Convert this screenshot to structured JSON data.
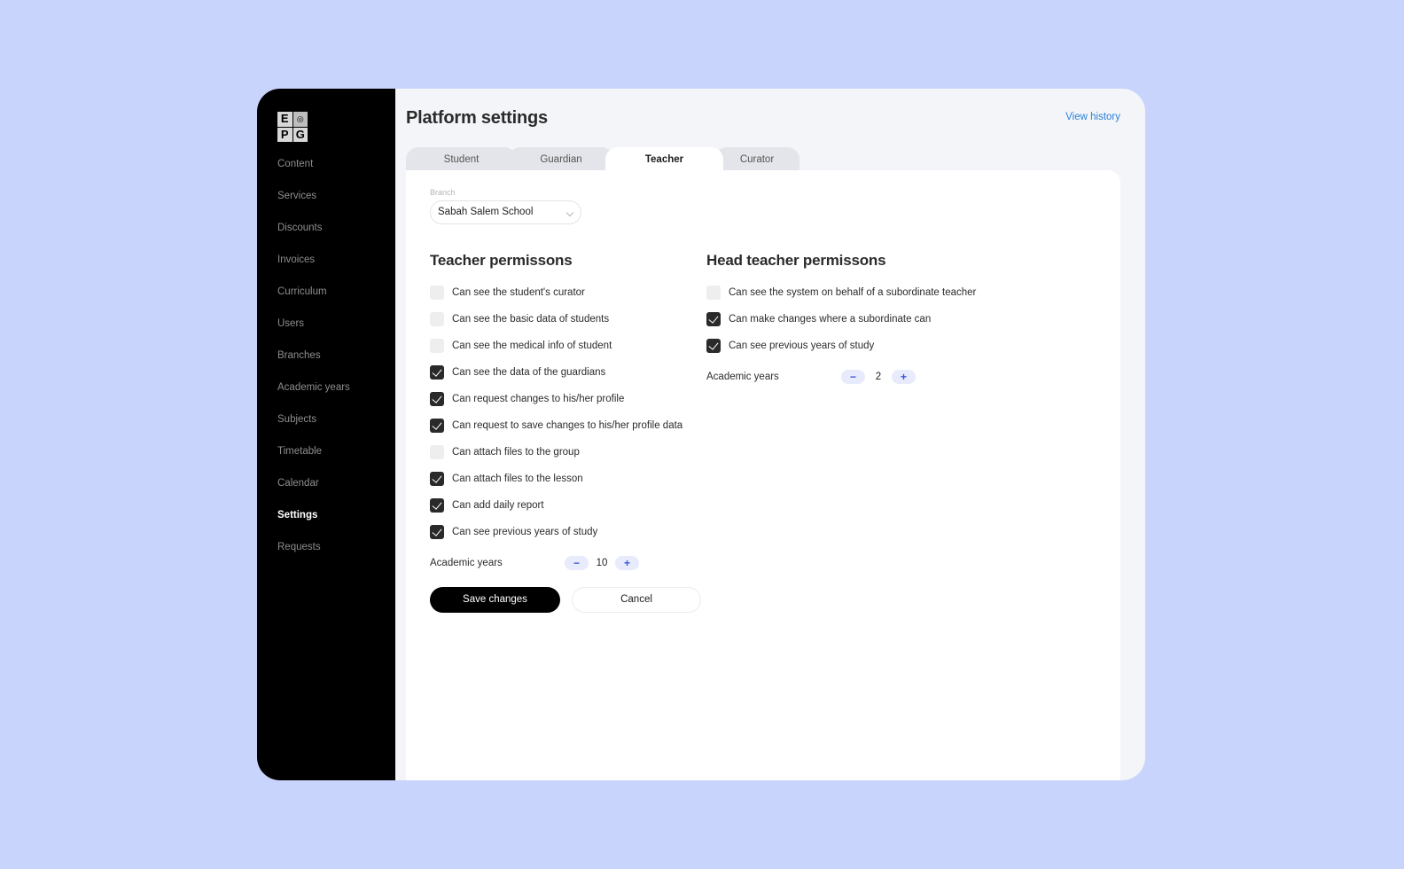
{
  "sidebar": {
    "logo": {
      "letters": [
        "E",
        "P",
        "G"
      ]
    },
    "items": [
      {
        "label": "Content"
      },
      {
        "label": "Services"
      },
      {
        "label": "Discounts"
      },
      {
        "label": "Invoices"
      },
      {
        "label": "Curriculum"
      },
      {
        "label": "Users"
      },
      {
        "label": "Branches"
      },
      {
        "label": "Academic years"
      },
      {
        "label": "Subjects"
      },
      {
        "label": "Timetable"
      },
      {
        "label": "Calendar"
      },
      {
        "label": "Settings",
        "active": true
      },
      {
        "label": "Requests"
      }
    ]
  },
  "header": {
    "title": "Platform settings",
    "view_history": "View history"
  },
  "tabs": [
    {
      "label": "Student"
    },
    {
      "label": "Guardian"
    },
    {
      "label": "Teacher",
      "active": true
    },
    {
      "label": "Curator"
    }
  ],
  "branch": {
    "label": "Branch",
    "value": "Sabah Salem School"
  },
  "teacher": {
    "title": "Teacher permissons",
    "permissions": [
      {
        "label": "Can see the student's curator",
        "checked": false
      },
      {
        "label": "Can see the basic data of students",
        "checked": false
      },
      {
        "label": "Can see the medical info of student",
        "checked": false
      },
      {
        "label": "Can see the data of the guardians",
        "checked": true
      },
      {
        "label": "Can request changes to his/her profile",
        "checked": true
      },
      {
        "label": "Can request to save changes to his/her profile data",
        "checked": true
      },
      {
        "label": "Can attach files to the group",
        "checked": false
      },
      {
        "label": "Can attach files to the lesson",
        "checked": true
      },
      {
        "label": "Can add daily report",
        "checked": true
      },
      {
        "label": "Can see previous years of study",
        "checked": true
      }
    ],
    "academic_years": {
      "label": "Academic years",
      "value": "10",
      "minus": "−",
      "plus": "+"
    }
  },
  "head_teacher": {
    "title": "Head teacher permissons",
    "permissions": [
      {
        "label": "Can see the system on behalf of a subordinate teacher",
        "checked": false
      },
      {
        "label": "Can make changes where a subordinate can",
        "checked": true
      },
      {
        "label": "Can see previous years of study",
        "checked": true
      }
    ],
    "academic_years": {
      "label": "Academic years",
      "value": "2",
      "minus": "−",
      "plus": "+"
    }
  },
  "actions": {
    "save": "Save changes",
    "cancel": "Cancel"
  },
  "colors": {
    "background": "#c9d4fd",
    "sidebar": "#000000",
    "link": "#2a80d8",
    "stepper_accent": "#3b55d9"
  }
}
